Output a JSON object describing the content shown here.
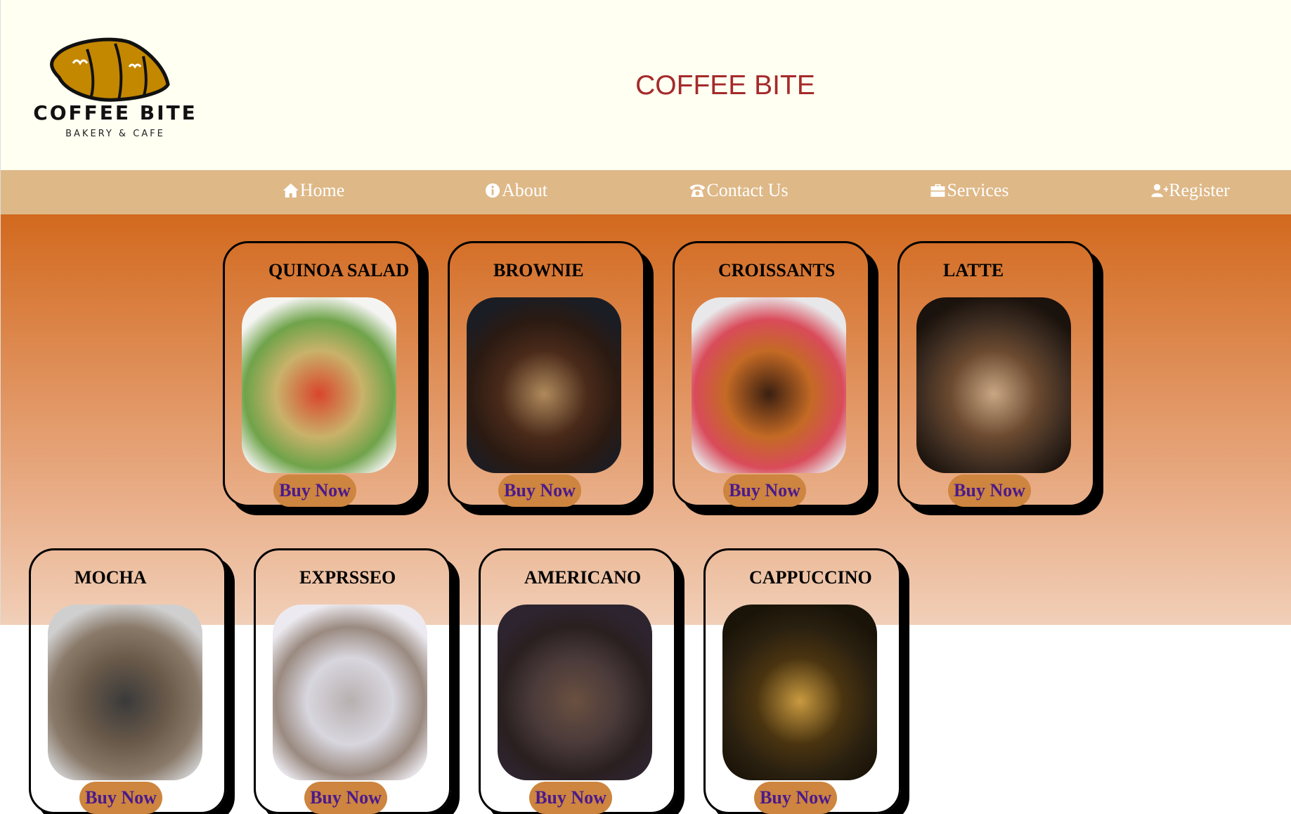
{
  "header": {
    "logo": {
      "brand": "COFFEE BITE",
      "tagline": "BAKERY & CAFE"
    },
    "title": "COFFEE BITE"
  },
  "nav": [
    {
      "label": "Home",
      "icon": "home-icon"
    },
    {
      "label": "About",
      "icon": "info-icon"
    },
    {
      "label": "Contact Us",
      "icon": "phone-icon"
    },
    {
      "label": "Services",
      "icon": "briefcase-icon"
    },
    {
      "label": "Register",
      "icon": "user-plus-icon"
    }
  ],
  "colors": {
    "title": "#a52a2a",
    "nav_bg": "#deb887",
    "button_bg": "#cd853f",
    "button_text": "#4b1a8c"
  },
  "products": [
    {
      "name": "QUINOA SALAD",
      "button": "Buy Now",
      "image": "quinoa-salad-image",
      "colors": [
        "#f4f4f2",
        "#c9b26a",
        "#d9452c",
        "#6fa34a"
      ]
    },
    {
      "name": "BROWNIE",
      "button": "Buy Now",
      "image": "brownie-image",
      "colors": [
        "#1b1d24",
        "#4a2a1a",
        "#b08a5c",
        "#2a1a12"
      ]
    },
    {
      "name": "CROISSANTS",
      "button": "Buy Now",
      "image": "croissants-image",
      "colors": [
        "#e8e8ea",
        "#c46a25",
        "#3a1f10",
        "#d94b5a"
      ]
    },
    {
      "name": "LATTE",
      "button": "Buy Now",
      "image": "latte-image",
      "colors": [
        "#1a120c",
        "#6b4a30",
        "#c9a784",
        "#3b2b20"
      ]
    },
    {
      "name": "MOCHA",
      "button": "Buy Now",
      "image": "mocha-image",
      "colors": [
        "#cfcfcf",
        "#6a5a4a",
        "#3a3a3a",
        "#8a7a6a"
      ]
    },
    {
      "name": "EXPRSSEO",
      "button": "Buy Now",
      "image": "espresso-image",
      "colors": [
        "#eceaf0",
        "#d8d6de",
        "#b8b0b0",
        "#9a8a80"
      ]
    },
    {
      "name": "AMERICANO",
      "button": "Buy Now",
      "image": "americano-image",
      "colors": [
        "#2e2430",
        "#4a3a3a",
        "#6a5040",
        "#2a2020"
      ]
    },
    {
      "name": "CAPPUCCINO",
      "button": "Buy Now",
      "image": "cappuccino-image",
      "colors": [
        "#1a1408",
        "#4a3410",
        "#c99a40",
        "#2a2010"
      ]
    }
  ]
}
